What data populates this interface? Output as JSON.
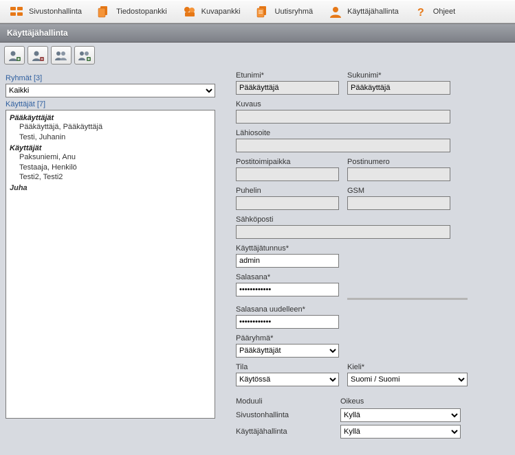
{
  "nav": {
    "items": [
      {
        "label": "Sivustonhallinta"
      },
      {
        "label": "Tiedostopankki"
      },
      {
        "label": "Kuvapankki"
      },
      {
        "label": "Uutisryhmä"
      },
      {
        "label": "Käyttäjähallinta"
      },
      {
        "label": "Ohjeet"
      }
    ]
  },
  "title": "Käyttäjähallinta",
  "left": {
    "groups_label": "Ryhmät [3]",
    "groups_selected": "Kaikki",
    "users_label": "Käyttäjät [7]",
    "list": {
      "g1": "Pääkäyttäjät",
      "g1_u1": "Pääkäyttäjä, Pääkäyttäjä",
      "g1_u2": "Testi, Juhanin",
      "g2": "Käyttäjät",
      "g2_u1": "Paksuniemi, Anu",
      "g2_u2": "Testaaja, Henkilö",
      "g2_u3": "Testi2, Testi2",
      "g3": "Juha"
    }
  },
  "form": {
    "etunimi_label": "Etunimi*",
    "etunimi_value": "Pääkäyttäjä",
    "sukunimi_label": "Sukunimi*",
    "sukunimi_value": "Pääkäyttäjä",
    "kuvaus_label": "Kuvaus",
    "kuvaus_value": "",
    "lahiosoite_label": "Lähiosoite",
    "lahiosoite_value": "",
    "postitoimipaikka_label": "Postitoimipaikka",
    "postitoimipaikka_value": "",
    "postinumero_label": "Postinumero",
    "postinumero_value": "",
    "puhelin_label": "Puhelin",
    "puhelin_value": "",
    "gsm_label": "GSM",
    "gsm_value": "",
    "sahkoposti_label": "Sähköposti",
    "sahkoposti_value": "",
    "kayttajatunnus_label": "Käyttäjätunnus*",
    "kayttajatunnus_value": "admin",
    "salasana_label": "Salasana*",
    "salasana_value": "••••••••••••",
    "salasana2_label": "Salasana uudelleen*",
    "salasana2_value": "••••••••••••",
    "paaryhma_label": "Pääryhmä*",
    "paaryhma_value": "Pääkäyttäjät",
    "tila_label": "Tila",
    "tila_value": "Käytössä",
    "kieli_label": "Kieli*",
    "kieli_value": "Suomi / Suomi"
  },
  "perms": {
    "module_header": "Moduuli",
    "right_header": "Oikeus",
    "r1_label": "Sivustonhallinta",
    "r1_value": "Kyllä",
    "r2_label": "Käyttäjähallinta",
    "r2_value": "Kyllä"
  }
}
